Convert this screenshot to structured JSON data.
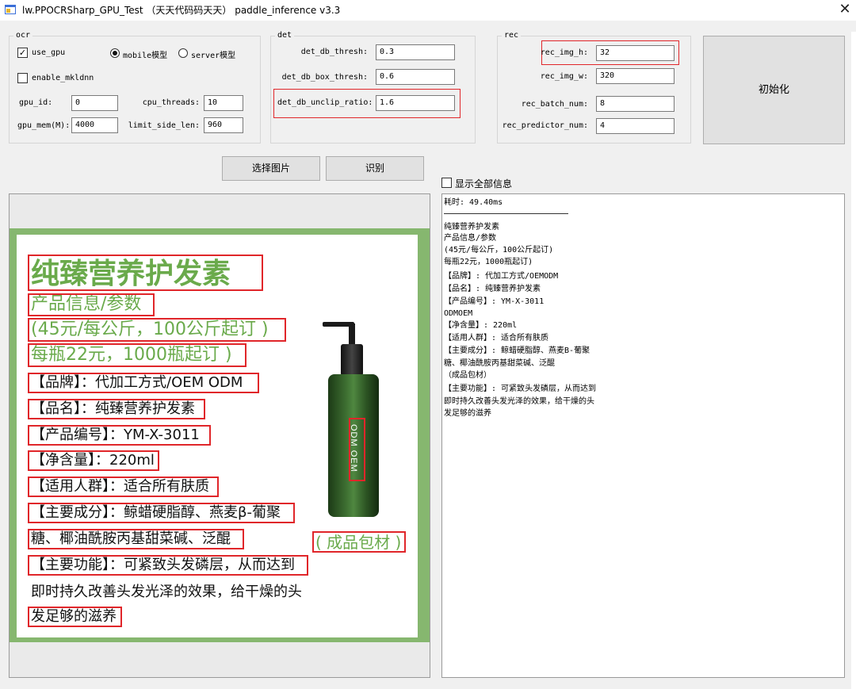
{
  "window": {
    "title": "lw.PPOCRSharp_GPU_Test （天天代码码天天） paddle_inference v3.3",
    "close": "✕"
  },
  "ocr": {
    "legend": "ocr",
    "use_gpu_label": "use_gpu",
    "use_gpu_checked": true,
    "mobile_label": "mobile模型",
    "server_label": "server模型",
    "selected_model": "mobile",
    "enable_mkldnn_label": "enable_mkldnn",
    "enable_mkldnn_checked": false,
    "gpu_id_label": "gpu_id:",
    "gpu_id_value": "0",
    "cpu_threads_label": "cpu_threads:",
    "cpu_threads_value": "10",
    "gpu_mem_label": "gpu_mem(M):",
    "gpu_mem_value": "4000",
    "limit_side_len_label": "limit_side_len:",
    "limit_side_len_value": "960"
  },
  "det": {
    "legend": "det",
    "thresh_label": "det_db_thresh:",
    "thresh_value": "0.3",
    "box_thresh_label": "det_db_box_thresh:",
    "box_thresh_value": "0.6",
    "unclip_label": "det_db_unclip_ratio:",
    "unclip_value": "1.6"
  },
  "rec": {
    "legend": "rec",
    "img_h_label": "rec_img_h:",
    "img_h_value": "32",
    "img_w_label": "rec_img_w:",
    "img_w_value": "320",
    "batch_label": "rec_batch_num:",
    "batch_value": "8",
    "predictor_label": "rec_predictor_num:",
    "predictor_value": "4"
  },
  "buttons": {
    "init": "初始化",
    "select_image": "选择图片",
    "recognize": "识别"
  },
  "show_all": {
    "label": "显示全部信息",
    "checked": false
  },
  "poster": {
    "title": "纯臻营养护发素",
    "lines": [
      "产品信息/参数",
      "(45元/每公斤，100公斤起订 )",
      "每瓶22元，1000瓶起订 )",
      "【品牌】：代加工方式/OEM ODM",
      "【品名】：纯臻营养护发素",
      "【产品编号】：YM-X-3011",
      "【净含量】：220ml",
      "【适用人群】：适合所有肤质",
      "【主要成分】：鲸蜡硬脂醇、燕麦β-葡聚",
      "糖、椰油酰胺丙基甜菜碱、泛醌",
      "【主要功能】：可紧致头发磷层，从而达到",
      "即时持久改善头发光泽的效果，给干燥的头",
      "发足够的滋养"
    ],
    "bottle_label": "ODM OEM",
    "packaging": "( 成品包材 )"
  },
  "output": {
    "elapsed": "耗时: 49.40ms",
    "lines": [
      "纯臻营养护发素",
      "产品信息/参数",
      "(45元/每公斤，100公斤起订)",
      "每瓶22元，1000瓶起订)",
      "【品牌】: 代加工方式/OEMODM",
      "【品名】: 纯臻营养护发素",
      "【产品编号】: YM-X-3011",
      "ODMOEM",
      "【净含量】: 220ml",
      "【适用人群】: 适合所有肤质",
      "【主要成分】: 鲸蜡硬脂醇、燕麦B-葡聚",
      "糖、椰油酰胺丙基甜菜碱、泛醌",
      "（成品包材）",
      "【主要功能】: 可紧致头发磷层，从而达到",
      "即时持久改善头发光泽的效果，给干燥的头",
      "发足够的滋养"
    ]
  },
  "colors": {
    "highlight_red": "#e0262a",
    "poster_green": "#6aaa4b",
    "poster_border": "#86b76f"
  }
}
